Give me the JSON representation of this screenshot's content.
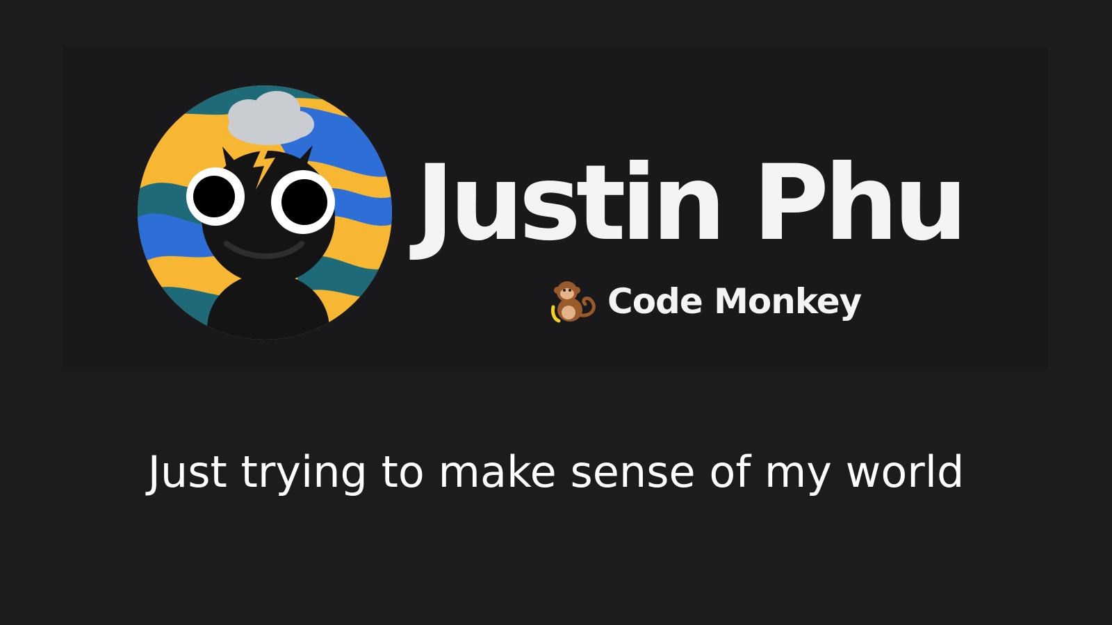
{
  "profile": {
    "name": "Justin Phu",
    "role": "Code Monkey",
    "role_icon": "monkey-icon",
    "avatar": "cartoon-creature-avatar-icon",
    "tagline": "Just trying to make sense of my world"
  },
  "colors": {
    "page_background": "#1c1b1d",
    "banner_background": "#19181a",
    "text": "#f4f4f4",
    "avatar_yellow": "#f7b733",
    "avatar_blue": "#2d6fd6",
    "avatar_teal": "#1e6a78"
  }
}
